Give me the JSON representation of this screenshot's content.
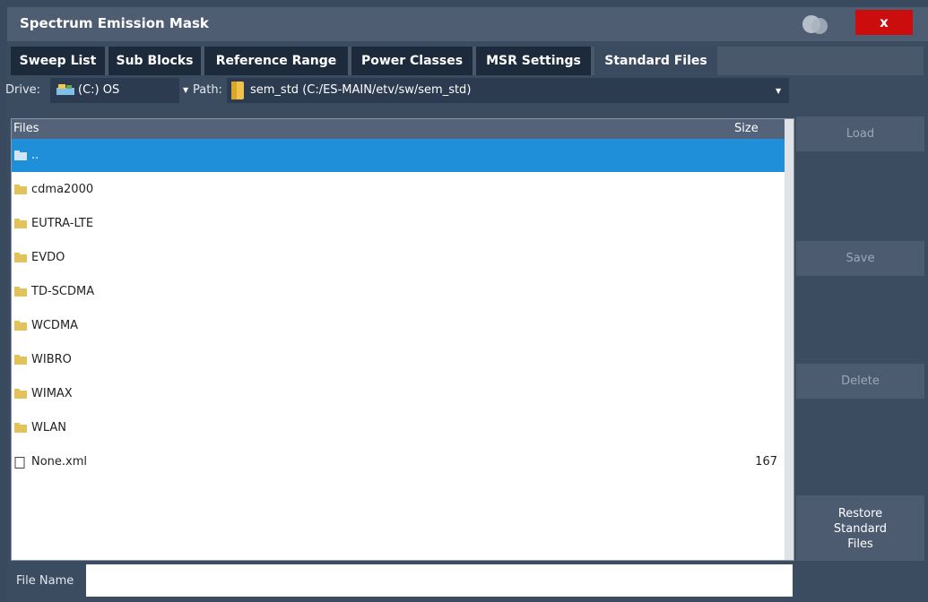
{
  "window": {
    "title": "Spectrum Emission Mask",
    "close_label": "x"
  },
  "tabs": [
    {
      "label": "Sweep List"
    },
    {
      "label": "Sub Blocks"
    },
    {
      "label": "Reference Range"
    },
    {
      "label": "Power Classes"
    },
    {
      "label": "MSR Settings"
    },
    {
      "label": "Standard Files",
      "active": true
    }
  ],
  "drive": {
    "label": "Drive:",
    "value": "(C:) OS"
  },
  "path": {
    "label": "Path:",
    "value": "sem_std (C:/ES-MAIN/etv/sw/sem_std)"
  },
  "file_list": {
    "columns": [
      "Files",
      "Size"
    ],
    "rows": [
      {
        "name": "..",
        "type": "folder",
        "size": "",
        "selected": true
      },
      {
        "name": "cdma2000",
        "type": "folder",
        "size": ""
      },
      {
        "name": "EUTRA-LTE",
        "type": "folder",
        "size": ""
      },
      {
        "name": "EVDO",
        "type": "folder",
        "size": ""
      },
      {
        "name": "TD-SCDMA",
        "type": "folder",
        "size": ""
      },
      {
        "name": "WCDMA",
        "type": "folder",
        "size": ""
      },
      {
        "name": "WIBRO",
        "type": "folder",
        "size": ""
      },
      {
        "name": "WIMAX",
        "type": "folder",
        "size": ""
      },
      {
        "name": "WLAN",
        "type": "folder",
        "size": ""
      },
      {
        "name": "None.xml",
        "type": "file",
        "size": "167"
      }
    ]
  },
  "buttons": {
    "load": "Load",
    "save": "Save",
    "delete": "Delete",
    "restore_line1": "Restore",
    "restore_line2": "Standard",
    "restore_line3": "Files"
  },
  "file_name": {
    "label": "File Name",
    "value": ""
  },
  "colors": {
    "selection": "#1e8fd8",
    "close": "#cc0d0d",
    "tab_bg": "#1c2a3b"
  }
}
